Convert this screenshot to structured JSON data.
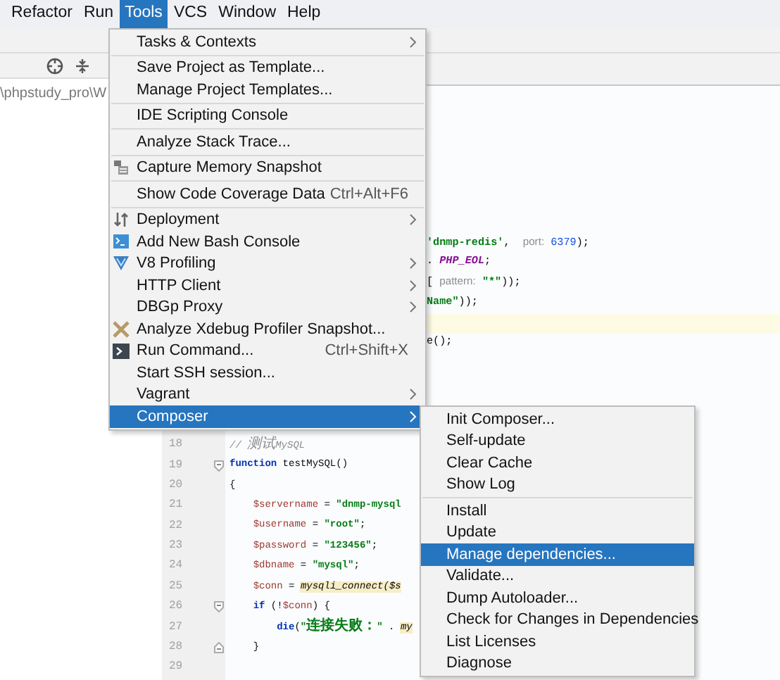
{
  "menu_bar": [
    {
      "label": "Refactor",
      "selected": false
    },
    {
      "label": "Run",
      "selected": false
    },
    {
      "label": "Tools",
      "selected": true
    },
    {
      "label": "VCS",
      "selected": false
    },
    {
      "label": "Window",
      "selected": false
    },
    {
      "label": "Help",
      "selected": false
    }
  ],
  "project_panel": {
    "path": "\\phpstudy_pro\\W"
  },
  "editor": {
    "upper_rows": [
      {
        "current": false,
        "segments": [
          {
            "text": "'dnmp-redis'",
            "kind": "string"
          },
          {
            "text": ",  ",
            "kind": "plain"
          },
          {
            "text": "port:",
            "kind": "hint"
          },
          {
            "text": " 6379",
            "kind": "number"
          },
          {
            "text": ");",
            "kind": "plain"
          }
        ]
      },
      {
        "current": false,
        "segments": [
          {
            "text": ". ",
            "kind": "plain"
          },
          {
            "text": "PHP_EOL",
            "kind": "constant"
          },
          {
            "text": ";",
            "kind": "plain"
          }
        ]
      },
      {
        "current": false,
        "segments": [
          {
            "text": "[ ",
            "kind": "plain"
          },
          {
            "text": "pattern:",
            "kind": "hint"
          },
          {
            "text": " \"*\"",
            "kind": "string"
          },
          {
            "text": "));",
            "kind": "plain"
          }
        ]
      },
      {
        "current": false,
        "segments": [
          {
            "text": "Name\"",
            "kind": "string"
          },
          {
            "text": "));",
            "kind": "plain"
          }
        ]
      },
      {
        "current": true
      },
      {
        "current": false,
        "segments": [
          {
            "text": "e();",
            "kind": "plain"
          }
        ]
      }
    ],
    "lines": [
      {
        "number": "18",
        "kind": "line",
        "segments": [
          {
            "text": "// 测试MySQL",
            "kind": "comment"
          }
        ]
      },
      {
        "number": "19",
        "kind": "fold-start",
        "segments": [
          {
            "text": "function",
            "kind": "keyword"
          },
          {
            "text": " testMySQL()",
            "kind": "plain"
          }
        ]
      },
      {
        "number": "20",
        "kind": "line",
        "segments": [
          {
            "text": "{",
            "kind": "plain"
          }
        ]
      },
      {
        "number": "21",
        "kind": "line",
        "segments": [
          {
            "text": "$servername",
            "kind": "variable"
          },
          {
            "text": " = ",
            "kind": "plain"
          },
          {
            "text": "\"dnmp-mysql",
            "kind": "string"
          }
        ]
      },
      {
        "number": "22",
        "kind": "line",
        "segments": [
          {
            "text": "$username",
            "kind": "variable"
          },
          {
            "text": " = ",
            "kind": "plain"
          },
          {
            "text": "\"root\"",
            "kind": "string"
          },
          {
            "text": ";",
            "kind": "plain"
          }
        ]
      },
      {
        "number": "23",
        "kind": "line",
        "segments": [
          {
            "text": "$password",
            "kind": "variable"
          },
          {
            "text": " = ",
            "kind": "plain"
          },
          {
            "text": "\"123456\"",
            "kind": "string"
          },
          {
            "text": ";",
            "kind": "plain"
          }
        ]
      },
      {
        "number": "24",
        "kind": "line",
        "segments": [
          {
            "text": "$dbname",
            "kind": "variable"
          },
          {
            "text": " = ",
            "kind": "plain"
          },
          {
            "text": "\"mysql\"",
            "kind": "string"
          },
          {
            "text": ";",
            "kind": "plain"
          }
        ]
      },
      {
        "number": "25",
        "kind": "line",
        "segments": [
          {
            "text": "$conn",
            "kind": "variable"
          },
          {
            "text": " = ",
            "kind": "plain"
          },
          {
            "text": "mysqli_connect($s",
            "kind": "call"
          }
        ]
      },
      {
        "number": "26",
        "kind": "fold-start",
        "segments": [
          {
            "text": "if",
            "kind": "keyword"
          },
          {
            "text": " (!",
            "kind": "plain"
          },
          {
            "text": "$conn",
            "kind": "variable"
          },
          {
            "text": ") {",
            "kind": "plain"
          }
        ]
      },
      {
        "number": "27",
        "kind": "line",
        "segments": [
          {
            "text": "die",
            "kind": "keyword"
          },
          {
            "text": "(",
            "kind": "plain"
          },
          {
            "text": "\"连接失败：\"",
            "kind": "string"
          },
          {
            "text": " . ",
            "kind": "plain"
          },
          {
            "text": "my",
            "kind": "call"
          }
        ]
      },
      {
        "number": "28",
        "kind": "fold-end",
        "segments": [
          {
            "text": "}",
            "kind": "plain"
          }
        ]
      },
      {
        "number": "29",
        "kind": "line"
      }
    ]
  },
  "tools_menu": {
    "items": [
      {
        "kind": "item",
        "label": "Tasks & Contexts",
        "submenu": true,
        "selected": false
      },
      {
        "kind": "separator"
      },
      {
        "kind": "item",
        "label": "Save Project as Template...",
        "selected": false
      },
      {
        "kind": "item",
        "label": "Manage Project Templates...",
        "selected": false
      },
      {
        "kind": "separator"
      },
      {
        "kind": "item",
        "label": "IDE Scripting Console",
        "selected": false
      },
      {
        "kind": "separator"
      },
      {
        "kind": "item",
        "label": "Analyze Stack Trace...",
        "selected": false
      },
      {
        "kind": "separator"
      },
      {
        "kind": "memory",
        "label": "Capture Memory Snapshot",
        "selected": false
      },
      {
        "kind": "separator"
      },
      {
        "kind": "item",
        "label": "Show Code Coverage Data",
        "shortcut": "Ctrl+Alt+F6",
        "selected": false
      },
      {
        "kind": "separator"
      },
      {
        "kind": "deploy",
        "label": "Deployment",
        "submenu": true,
        "selected": false
      },
      {
        "kind": "console",
        "label": "Add New Bash Console",
        "selected": false
      },
      {
        "kind": "profiling",
        "label": "V8 Profiling",
        "submenu": true,
        "selected": false
      },
      {
        "kind": "item",
        "label": "HTTP Client",
        "submenu": true,
        "selected": false
      },
      {
        "kind": "item",
        "label": "DBGp Proxy",
        "submenu": true,
        "selected": false
      },
      {
        "kind": "xdebug",
        "label": "Analyze Xdebug Profiler Snapshot...",
        "selected": false
      },
      {
        "kind": "terminal",
        "label": "Run Command...",
        "shortcut": "Ctrl+Shift+X",
        "selected": false
      },
      {
        "kind": "item",
        "label": "Start SSH session...",
        "selected": false
      },
      {
        "kind": "item",
        "label": "Vagrant",
        "submenu": true,
        "selected": false
      },
      {
        "kind": "item",
        "label": "Composer",
        "submenu": true,
        "selected": true
      }
    ]
  },
  "composer_submenu": {
    "items": [
      {
        "kind": "item",
        "label": "Init Composer...",
        "selected": false
      },
      {
        "kind": "item",
        "label": "Self-update",
        "selected": false
      },
      {
        "kind": "item",
        "label": "Clear Cache",
        "selected": false
      },
      {
        "kind": "item",
        "label": "Show Log",
        "selected": false
      },
      {
        "kind": "separator"
      },
      {
        "kind": "item",
        "label": "Install",
        "selected": false
      },
      {
        "kind": "item",
        "label": "Update",
        "selected": false
      },
      {
        "kind": "item",
        "label": "Manage dependencies...",
        "selected": true
      },
      {
        "kind": "item",
        "label": "Validate...",
        "selected": false
      },
      {
        "kind": "item",
        "label": "Dump Autoloader...",
        "selected": false
      },
      {
        "kind": "item",
        "label": "Check for Changes in Dependencies",
        "selected": false
      },
      {
        "kind": "item",
        "label": "List Licenses",
        "selected": false
      },
      {
        "kind": "item",
        "label": "Diagnose",
        "selected": false
      }
    ]
  }
}
